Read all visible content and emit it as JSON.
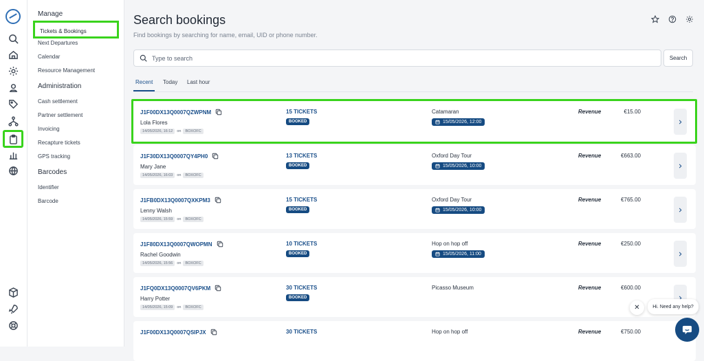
{
  "rail": {
    "icons": [
      "logo-icon",
      "search-icon",
      "home-icon",
      "gear-icon",
      "user-pin-icon",
      "tag-icon",
      "network-icon",
      "clipboard-icon",
      "bar-chart-icon",
      "globe-icon",
      "box-icon",
      "rocket-icon",
      "lifebuoy-icon"
    ]
  },
  "sidenav": {
    "manage_title": "Manage",
    "manage_items": [
      "Tickets & Bookings",
      "Next Departures",
      "Calendar",
      "Resource Management"
    ],
    "admin_title": "Administration",
    "admin_items": [
      "Cash settlement",
      "Partner settlement",
      "Invoicing",
      "Recapture tickets",
      "GPS tracking"
    ],
    "barcodes_title": "Barcodes",
    "barcode_items": [
      "Identifier",
      "Barcode"
    ]
  },
  "header": {
    "title": "Search bookings",
    "subtitle": "Find bookings by searching for name, email, UID or phone number."
  },
  "search": {
    "placeholder": "Type to search",
    "button": "Search"
  },
  "tabs": [
    "Recent",
    "Today",
    "Last hour"
  ],
  "bookings": [
    {
      "uid": "J1F00DX13Q0007QZWPNM",
      "name": "Lola Flores",
      "created": "14/05/2026, 16:12",
      "on": "on",
      "channel": "BOXOFC",
      "tickets": "15 TICKETS",
      "status": "BOOKED",
      "product": "Catamaran",
      "departure": "15/05/2026, 12:00",
      "revenue_label": "Revenue",
      "revenue": "€15.00"
    },
    {
      "uid": "J1F30DX13Q0007QY4PH0",
      "name": "Mary Jane",
      "created": "14/05/2026, 16:03",
      "on": "on",
      "channel": "BOXOFC",
      "tickets": "13 TICKETS",
      "status": "BOOKED",
      "product": "Oxford Day Tour",
      "departure": "15/05/2026, 10:00",
      "revenue_label": "Revenue",
      "revenue": "€663.00"
    },
    {
      "uid": "J1FB0DX13Q0007QXKPM3",
      "name": "Lenny Walsh",
      "created": "14/05/2026, 15:59",
      "on": "on",
      "channel": "BOXOFC",
      "tickets": "15 TICKETS",
      "status": "BOOKED",
      "product": "Oxford Day Tour",
      "departure": "15/05/2026, 10:00",
      "revenue_label": "Revenue",
      "revenue": "€765.00"
    },
    {
      "uid": "J1F80DX13Q0007QWOPMN",
      "name": "Rachel Goodwin",
      "created": "14/05/2026, 15:56",
      "on": "on",
      "channel": "BOXOFC",
      "tickets": "10 TICKETS",
      "status": "BOOKED",
      "product": "Hop on hop off",
      "departure": "15/05/2026, 11:00",
      "revenue_label": "Revenue",
      "revenue": "€250.00"
    },
    {
      "uid": "J1FQ0DX13Q0007QV6PKM",
      "name": "Harry Potter",
      "created": "14/05/2026, 15:09",
      "on": "on",
      "channel": "BOXOFC",
      "tickets": "30 TICKETS",
      "status": "BOOKED",
      "product": "Picasso Museum",
      "departure": "",
      "revenue_label": "Revenue",
      "revenue": "€600.00"
    },
    {
      "uid": "J1F00DX13Q0007QSIPJX",
      "name": "",
      "created": "",
      "on": "",
      "channel": "",
      "tickets": "30 TICKETS",
      "status": "",
      "product": "Hop on hop off",
      "departure": "",
      "revenue_label": "Revenue",
      "revenue": "€750.00"
    }
  ],
  "chat": {
    "close": "✕",
    "message": "Hi. Need any help?"
  }
}
